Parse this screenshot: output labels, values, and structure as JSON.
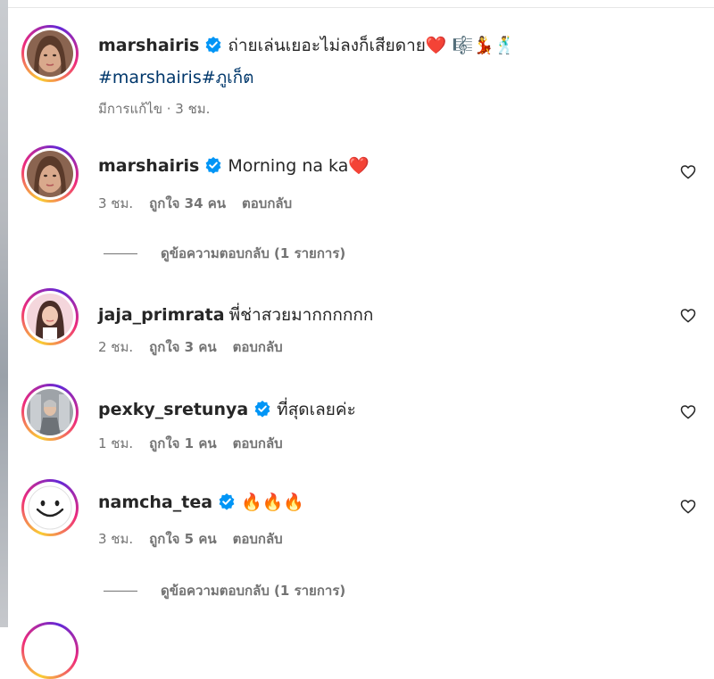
{
  "caption": {
    "username": "marshairis",
    "text": "ถ่ายเล่นเยอะไม่ลงก็เสียดาย❤️ 🎼💃🕺",
    "hashtags": "#marshairis#ภูเก็ต",
    "meta": "มีการแก้ไข · 3 ชม."
  },
  "comments": [
    {
      "username": "marshairis",
      "verified": true,
      "text": "Morning na ka❤️",
      "time": "3 ชม.",
      "likes": "ถูกใจ 34 คน",
      "reply": "ตอบกลับ",
      "view_replies": "ดูข้อความตอบกลับ (1 รายการ)"
    },
    {
      "username": "jaja_primrata",
      "verified": false,
      "text": "พี่ช่าสวยมากกกกกก",
      "time": "2 ชม.",
      "likes": "ถูกใจ 3 คน",
      "reply": "ตอบกลับ"
    },
    {
      "username": "pexky_sretunya",
      "verified": true,
      "text": "ที่สุดเลยค่ะ",
      "time": "1 ชม.",
      "likes": "ถูกใจ 1 คน",
      "reply": "ตอบกลับ"
    },
    {
      "username": "namcha_tea",
      "verified": true,
      "text": "🔥🔥🔥",
      "time": "3 ชม.",
      "likes": "ถูกใจ 5 คน",
      "reply": "ตอบกลับ",
      "view_replies": "ดูข้อความตอบกลับ (1 รายการ)"
    }
  ],
  "icons": {
    "verified": "verified-badge-icon",
    "like": "heart-outline-icon"
  },
  "colors": {
    "verified_blue": "#0095f6",
    "hashtag": "#00376b",
    "meta_gray": "#737373"
  }
}
